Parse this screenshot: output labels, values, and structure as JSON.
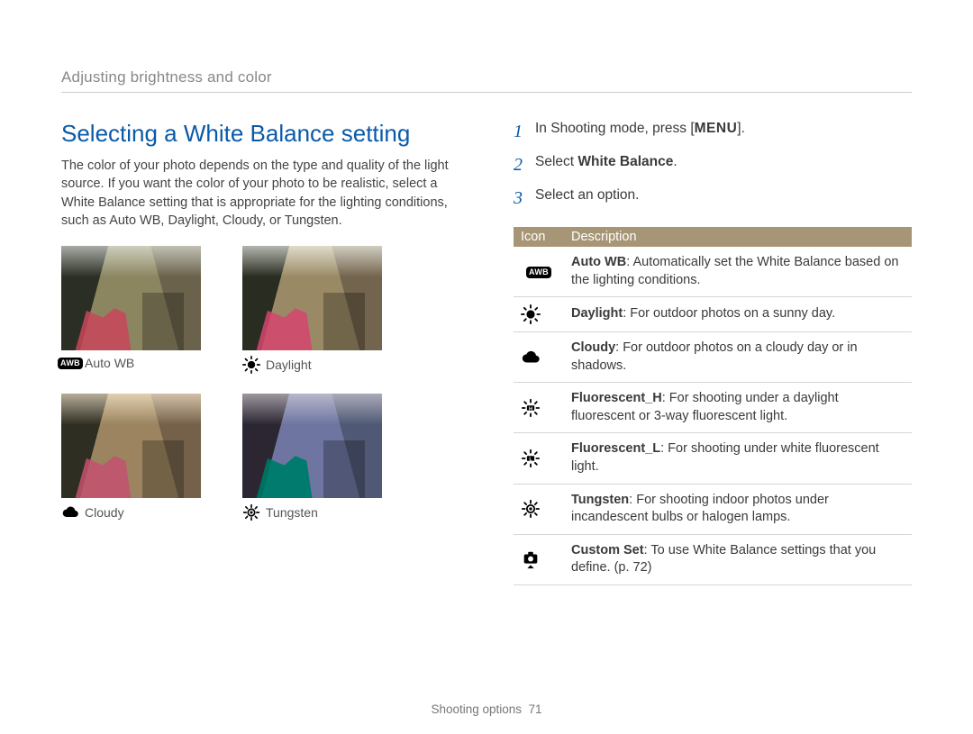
{
  "breadcrumb": "Adjusting brightness and color",
  "title": "Selecting a White Balance setting",
  "intro": "The color of your photo depends on the type and quality of the light source. If you want the color of your photo to be realistic, select a White Balance setting that is appropriate for the lighting conditions, such as Auto WB, Daylight, Cloudy, or Tungsten.",
  "thumbs": [
    {
      "label": "Auto WB",
      "icon": "awb"
    },
    {
      "label": "Daylight",
      "icon": "daylight"
    },
    {
      "label": "Cloudy",
      "icon": "cloudy"
    },
    {
      "label": "Tungsten",
      "icon": "tungsten"
    }
  ],
  "steps": [
    {
      "n": "1",
      "pre": "In Shooting mode, press [",
      "key": "MENU",
      "post": "]."
    },
    {
      "n": "2",
      "pre": "Select ",
      "bold": "White Balance",
      "post": "."
    },
    {
      "n": "3",
      "pre": "Select an option.",
      "bold": "",
      "post": ""
    }
  ],
  "table": {
    "headers": [
      "Icon",
      "Description"
    ],
    "rows": [
      {
        "icon": "awb",
        "bold": "Auto WB",
        "text": ": Automatically set the White Balance based on the lighting conditions."
      },
      {
        "icon": "daylight",
        "bold": "Daylight",
        "text": ": For outdoor photos on a sunny day."
      },
      {
        "icon": "cloudy",
        "bold": "Cloudy",
        "text": ": For outdoor photos on a cloudy day or in shadows."
      },
      {
        "icon": "fluorescent-h",
        "bold": "Fluorescent_H",
        "text": ": For shooting under a daylight fluorescent or 3-way fluorescent light."
      },
      {
        "icon": "fluorescent-l",
        "bold": "Fluorescent_L",
        "text": ": For shooting under white fluorescent light."
      },
      {
        "icon": "tungsten",
        "bold": "Tungsten",
        "text": ": For shooting indoor photos under incandescent bulbs or halogen lamps."
      },
      {
        "icon": "custom",
        "bold": "Custom Set",
        "text": ": To use White Balance settings that you define. (p. 72)"
      }
    ]
  },
  "footer": {
    "section": "Shooting options",
    "page": "71"
  },
  "icons": {
    "awb_text": "AWB"
  }
}
